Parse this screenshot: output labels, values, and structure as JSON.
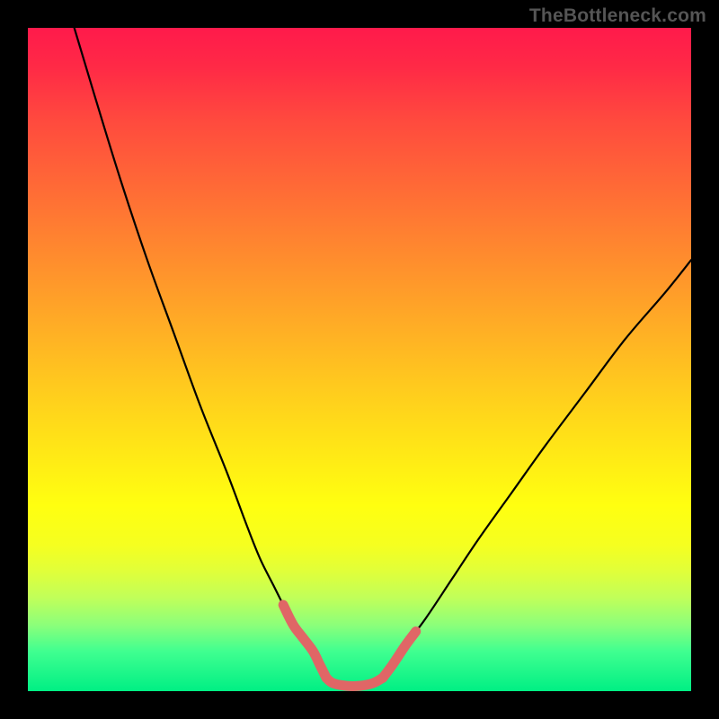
{
  "watermark": "TheBottleneck.com",
  "chart_data": {
    "type": "line",
    "title": "",
    "xlabel": "",
    "ylabel": "",
    "xlim": [
      0,
      100
    ],
    "ylim": [
      0,
      100
    ],
    "grid": false,
    "legend": false,
    "series": [
      {
        "name": "left-curve",
        "x": [
          7,
          10,
          14,
          18,
          22,
          26,
          30,
          33,
          35,
          37,
          38.5,
          40,
          41.5,
          43,
          44,
          45
        ],
        "y": [
          100,
          90,
          77,
          65,
          54,
          43,
          33,
          25,
          20,
          16,
          13,
          10,
          8,
          6,
          4,
          2
        ]
      },
      {
        "name": "flat-valley",
        "x": [
          45,
          46,
          48,
          50,
          52,
          53.5
        ],
        "y": [
          2,
          1.2,
          0.8,
          0.8,
          1.2,
          2
        ]
      },
      {
        "name": "right-curve",
        "x": [
          53.5,
          55,
          57,
          60,
          64,
          68,
          73,
          78,
          84,
          90,
          96,
          100
        ],
        "y": [
          2,
          4,
          7,
          11,
          17,
          23,
          30,
          37,
          45,
          53,
          60,
          65
        ]
      }
    ],
    "highlights": [
      {
        "name": "left-threshold-segment",
        "x": [
          38.5,
          40,
          41.5,
          43,
          44,
          45
        ],
        "y": [
          13,
          10,
          8,
          6,
          4,
          2
        ],
        "color": "#e06666"
      },
      {
        "name": "flat-valley-segment",
        "x": [
          45,
          46,
          48,
          50,
          52,
          53.5
        ],
        "y": [
          2,
          1.2,
          0.8,
          0.8,
          1.2,
          2
        ],
        "color": "#e06666"
      },
      {
        "name": "right-threshold-segment",
        "x": [
          53.5,
          55,
          57,
          58.5
        ],
        "y": [
          2,
          4,
          7,
          9
        ],
        "color": "#e06666"
      }
    ],
    "colors": {
      "curve": "#000000",
      "highlight": "#e06666",
      "background_top": "#ff1a4b",
      "background_bottom": "#00ef84",
      "frame": "#000000"
    }
  }
}
